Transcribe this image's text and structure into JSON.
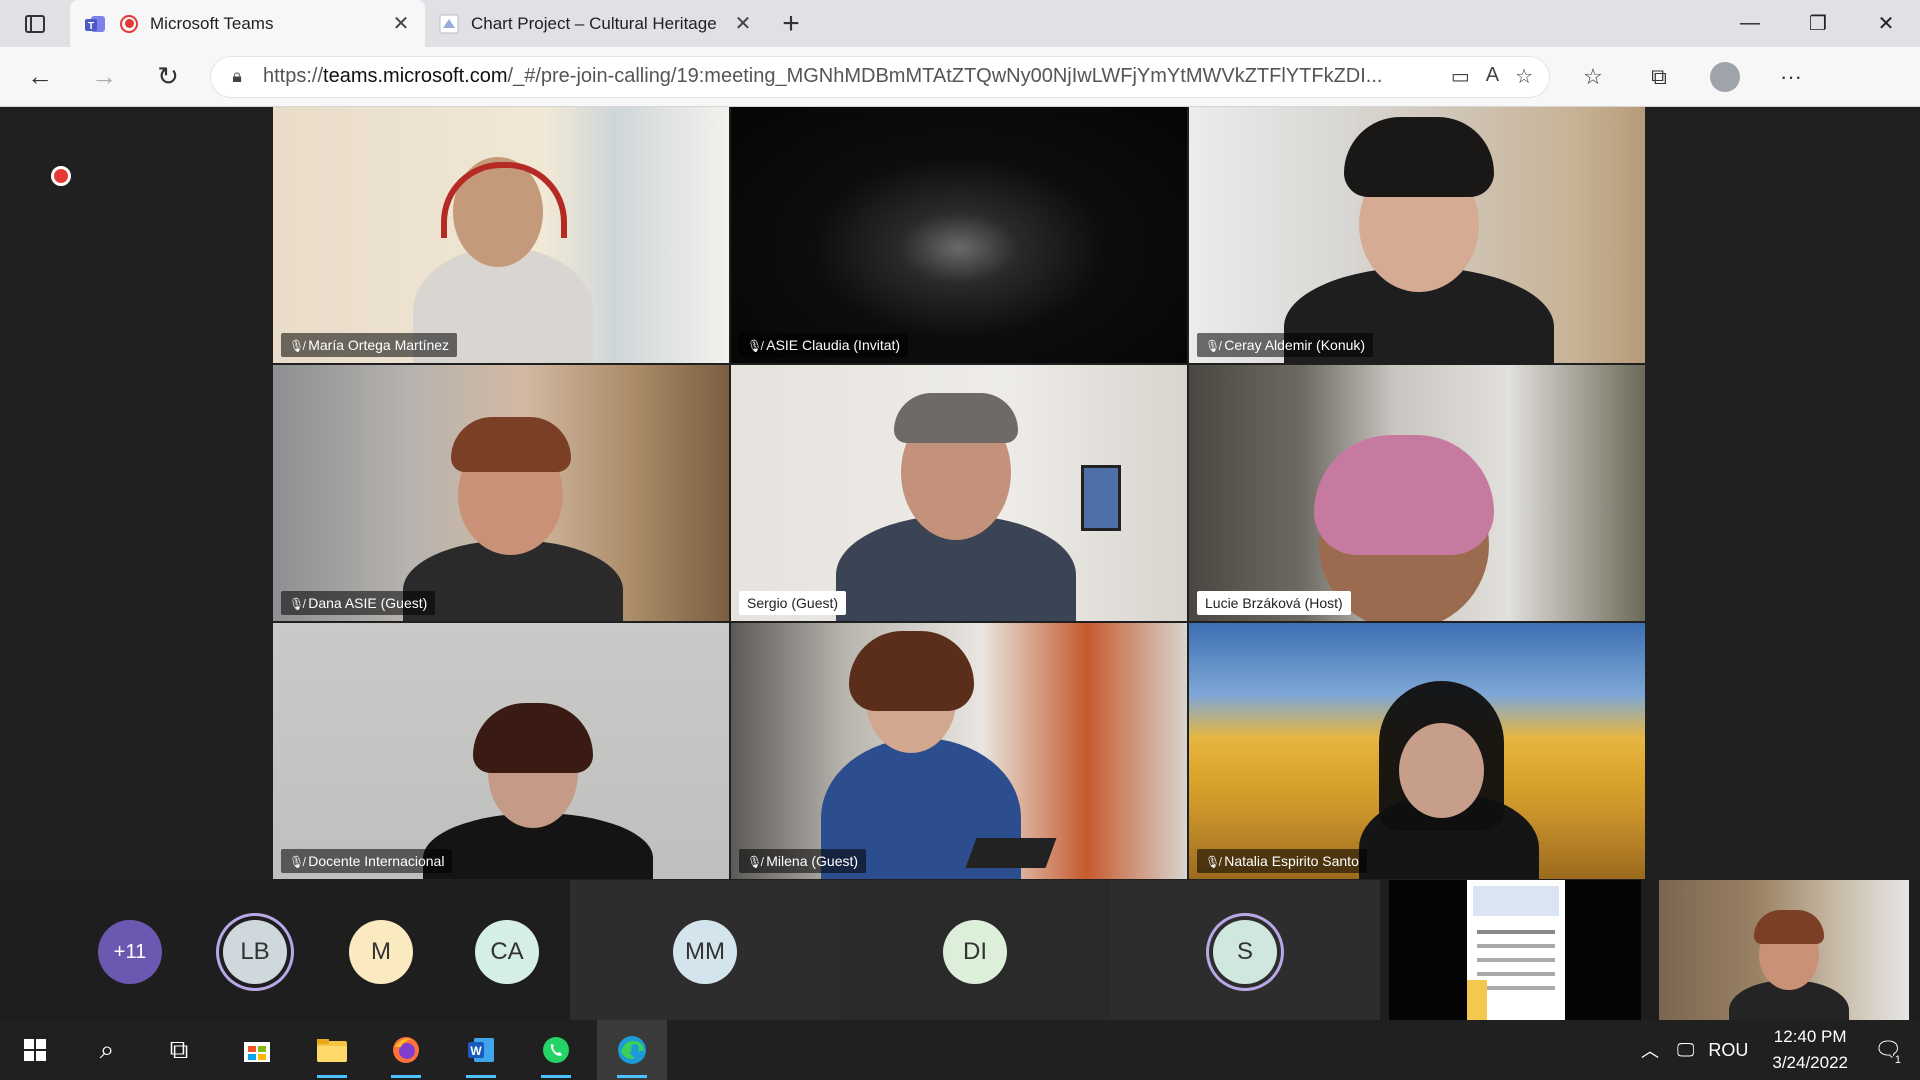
{
  "browser": {
    "tabs": [
      {
        "title": "Microsoft Teams",
        "active": true
      },
      {
        "title": "Chart Project – Cultural Heritage",
        "active": false
      }
    ],
    "url_prefix": "https://",
    "url_domain": "teams.microsoft.com",
    "url_rest": "/_#/pre-join-calling/19:meeting_MGNhMDBmMTAtZTQwNy00NjIwLWFjYmYtMWVkZTFlYTFkZDI..."
  },
  "meeting": {
    "recording": true,
    "participants": [
      {
        "name": "María Ortega Martínez",
        "muted": true,
        "label_style": "dark"
      },
      {
        "name": "ASIE Claudia (Invitat)",
        "muted": true,
        "label_style": "dark"
      },
      {
        "name": "Ceray Aldemir (Konuk)",
        "muted": true,
        "label_style": "dark"
      },
      {
        "name": "Dana ASIE (Guest)",
        "muted": true,
        "label_style": "dark"
      },
      {
        "name": "Sergio (Guest)",
        "muted": false,
        "label_style": "light"
      },
      {
        "name": "Lucie Brzáková (Host)",
        "muted": false,
        "label_style": "light"
      },
      {
        "name": "Docente Internacional",
        "muted": true,
        "label_style": "dark"
      },
      {
        "name": "Milena (Guest)",
        "muted": true,
        "label_style": "dark"
      },
      {
        "name": "Natalia Espirito Santo",
        "muted": true,
        "label_style": "dark"
      }
    ],
    "strip": {
      "overflow_count": "+11",
      "avatars": [
        {
          "initials": "LB",
          "color": "#cfd8dc"
        },
        {
          "initials": "M",
          "color": "#fbe9c0"
        },
        {
          "initials": "CA",
          "color": "#d6efe6"
        },
        {
          "initials": "MM",
          "color": "#d4e4ec"
        },
        {
          "initials": "DI",
          "color": "#dcefd8"
        },
        {
          "initials": "S",
          "color": "#cfe7dc"
        }
      ]
    }
  },
  "taskbar": {
    "language": "ROU",
    "time": "12:40 PM",
    "date": "3/24/2022",
    "notifications": "1"
  }
}
